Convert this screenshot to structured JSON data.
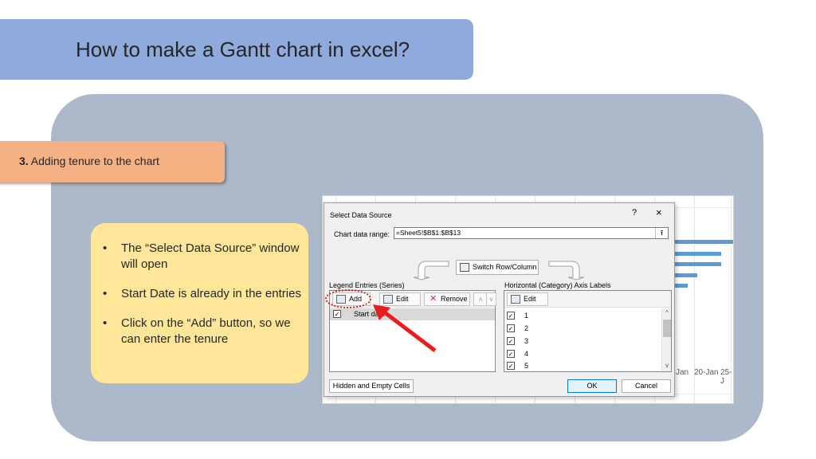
{
  "slide": {
    "title": "How to make a Gantt chart in excel?",
    "step_number": "3.",
    "step_text": " Adding tenure to the chart",
    "bullets": [
      "The “Select Data Source” window will open",
      "Start Date is already in the entries",
      "Click on the “Add” button, so we can enter the tenure"
    ]
  },
  "background_chart": {
    "axis_labels": [
      "Jan",
      "20-Jan",
      "25-J"
    ],
    "bar_color": "#5b9bd5"
  },
  "dialog": {
    "title": "Select Data Source",
    "help": "?",
    "close": "×",
    "range_label": "Chart data range:",
    "range_value": "=Sheet5!$B$1:$B$13",
    "range_collapse": "⭱",
    "switch_label": "Switch Row/Column",
    "legend_label": "Legend Entries (Series)",
    "horizontal_label": "Horizontal (Category) Axis Labels",
    "add_label": "Add",
    "edit_label": "Edit",
    "remove_label": "Remove",
    "move_up": "∧",
    "move_down": "∨",
    "edit_axis_label": "Edit",
    "series": [
      {
        "label": "Start date",
        "checked": "☑"
      }
    ],
    "categories": [
      "1",
      "2",
      "3",
      "4",
      "5"
    ],
    "check_glyph": "✓",
    "scroll_up": "^",
    "scroll_down": "v",
    "hidden_cells_label": "Hidden and Empty Cells",
    "ok_label": "OK",
    "cancel_label": "Cancel"
  },
  "colors": {
    "title_banner": "#8faadc",
    "content_panel": "#acb9ca",
    "step_tab": "#f4b183",
    "bullet_box": "#ffe699",
    "highlight": "#d42020"
  }
}
